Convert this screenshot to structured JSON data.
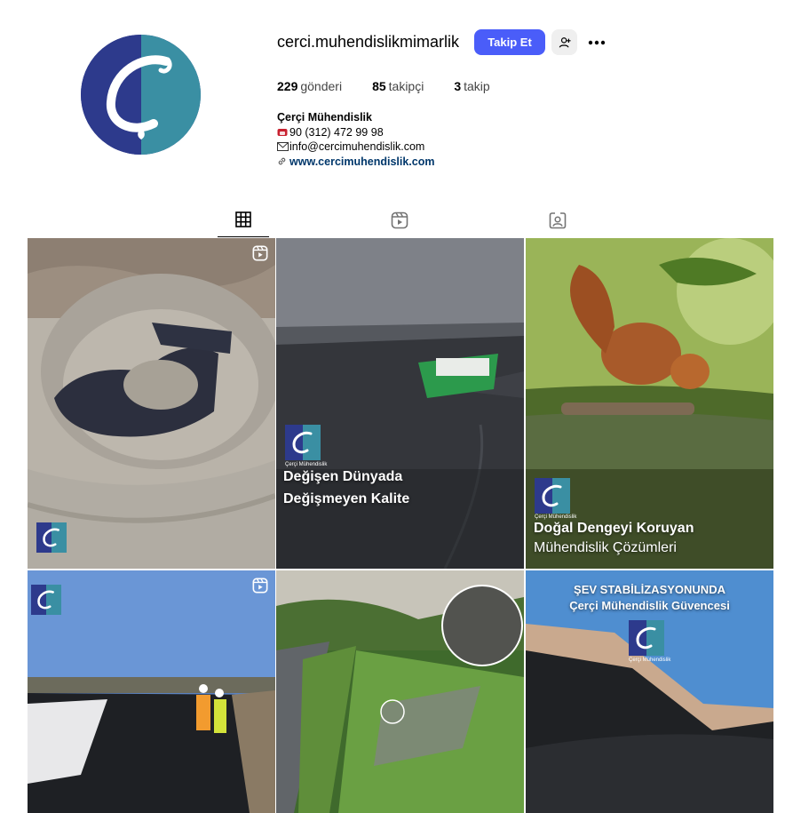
{
  "profile": {
    "username": "cerci.muhendislikmimarlik",
    "follow_label": "Takip Et",
    "stats": [
      {
        "count": "229",
        "label": "gönderi"
      },
      {
        "count": "85",
        "label": "takipçi"
      },
      {
        "count": "3",
        "label": "takip"
      }
    ],
    "bio": {
      "name": "Çerçi Mühendislik",
      "phone": "90 (312) 472 99 98",
      "email": "info@cercimuhendislik.com",
      "website": "www.cercimuhendislik.com"
    }
  },
  "tabs": [
    {
      "icon": "grid-icon",
      "active": true
    },
    {
      "icon": "reels-icon",
      "active": false
    },
    {
      "icon": "tagged-icon",
      "active": false
    }
  ],
  "posts": {
    "p2": {
      "line1": "Değişen Dünyada",
      "line2": "Değişmeyen Kalite",
      "brand": "Çerçi Mühendislik"
    },
    "p3": {
      "line1": "Doğal Dengeyi Koruyan",
      "line2": "Mühendislik Çözümleri",
      "brand": "Çerçi Mühendislik"
    },
    "p6": {
      "line1": "ŞEV STABİLİZASYONUNDA",
      "line2": "Çerçi Mühendislik Güvencesi",
      "brand": "Çerçi Mühendislik"
    }
  },
  "colors": {
    "accent": "#4a5df9",
    "link": "#00376b",
    "logo_navy": "#2d3a8c",
    "logo_teal": "#3a8fa3"
  }
}
